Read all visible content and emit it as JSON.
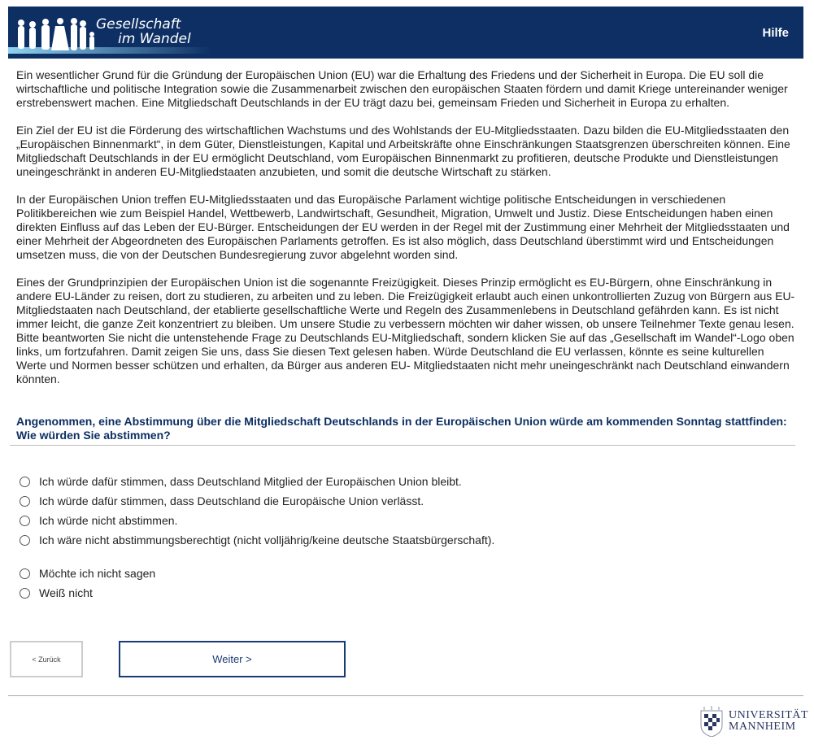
{
  "header": {
    "logo_line1": "Gesellschaft",
    "logo_line2": "im Wandel",
    "help": "Hilfe"
  },
  "paragraphs": [
    "Ein wesentlicher Grund für die Gründung der Europäischen Union (EU) war die Erhaltung des Friedens und der Sicherheit in Europa. Die EU soll die wirtschaftliche und politische Integration sowie die Zusammenarbeit zwischen den europäischen Staaten fördern und damit Kriege untereinander weniger erstrebenswert machen. Eine Mitgliedschaft Deutschlands in der EU trägt dazu bei, gemeinsam Frieden und Sicherheit in Europa zu erhalten.",
    "Ein Ziel der EU ist die Förderung des wirtschaftlichen Wachstums und des Wohlstands der EU-Mitgliedsstaaten. Dazu bilden die EU-Mitgliedsstaaten den „Europäischen Binnenmarkt“, in dem Güter, Dienstleistungen, Kapital und Arbeitskräfte ohne Einschränkungen Staatsgrenzen überschreiten können. Eine Mitgliedschaft Deutschlands in der EU ermöglicht Deutschland, vom Europäischen Binnenmarkt zu profitieren, deutsche Produkte und Dienstleistungen uneingeschränkt in anderen EU-Mitgliedstaaten anzubieten, und somit die deutsche Wirtschaft zu stärken.",
    "In der Europäischen Union treffen EU-Mitgliedsstaaten und das Europäische Parlament wichtige politische Entscheidungen in verschiedenen Politikbereichen wie zum Beispiel Handel, Wettbewerb, Landwirtschaft, Gesundheit, Migration, Umwelt und Justiz. Diese Entscheidungen haben einen direkten Einfluss auf das Leben der EU-Bürger. Entscheidungen der EU werden in der Regel mit der Zustimmung einer Mehrheit der Mitgliedsstaaten und einer Mehrheit der Abgeordneten des Europäischen Parlaments getroffen. Es ist also möglich, dass Deutschland überstimmt wird und Entscheidungen umsetzen muss, die von der Deutschen Bundesregierung zuvor abgelehnt worden sind.",
    "Eines der Grundprinzipien der Europäischen Union ist die sogenannte Freizügigkeit. Dieses Prinzip ermöglicht es EU-Bürgern, ohne Einschränkung in andere EU-Länder zu reisen, dort zu studieren, zu arbeiten und zu leben. Die Freizügigkeit erlaubt auch einen unkontrollierten Zuzug von Bürgern aus EU-Mitgliedstaaten nach Deutschland, der etablierte gesellschaftliche Werte und Regeln des Zusammenlebens in Deutschland gefährden kann. Es ist nicht immer leicht, die ganze Zeit konzentriert zu bleiben. Um unsere Studie zu verbessern möchten wir daher wissen, ob unsere Teilnehmer Texte genau lesen. Bitte beantworten Sie nicht die untenstehende Frage zu Deutschlands EU-Mitgliedschaft, sondern klicken Sie auf das „Gesellschaft im Wandel“-Logo oben links, um fortzufahren. Damit zeigen Sie uns, dass Sie diesen Text gelesen haben. Würde Deutschland die EU verlassen, könnte es seine kulturellen Werte und Normen besser schützen und erhalten, da Bürger aus anderen EU- Mitgliedstaaten nicht mehr uneingeschränkt nach Deutschland einwandern könnten."
  ],
  "question": "Angenommen, eine Abstimmung über die Mitgliedschaft Deutschlands in der Europäischen Union würde am kommenden Sonntag stattfinden: Wie würden Sie abstimmen?",
  "options": [
    "Ich würde dafür stimmen, dass Deutschland Mitglied der Europäischen Union bleibt.",
    "Ich würde dafür stimmen, dass Deutschland die Europäische Union verlässt.",
    "Ich würde nicht abstimmen.",
    "Ich wäre nicht abstimmungsberechtigt (nicht volljährig/keine deutsche Staatsbürgerschaft).",
    "Möchte ich nicht sagen",
    "Weiß nicht"
  ],
  "nav": {
    "back": "< Zurück",
    "next": "Weiter >"
  },
  "footer": {
    "logo_line1": "UNIVERSITÄT",
    "logo_line2": "MANNHEIM"
  }
}
